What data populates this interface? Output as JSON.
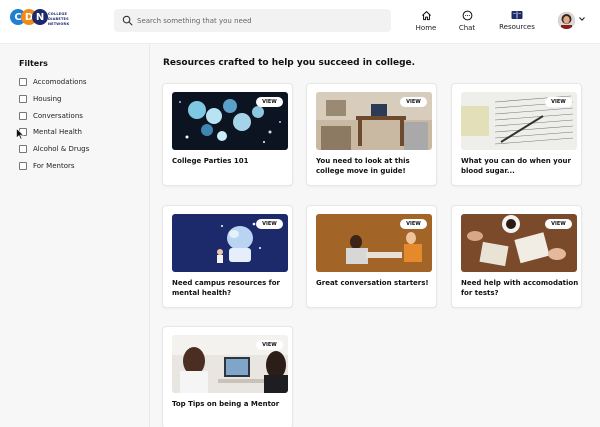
{
  "header": {
    "logo": {
      "letters": [
        "C",
        "D",
        "N"
      ],
      "text_lines": [
        "COLLEGE",
        "DIABETES",
        "NETWORK"
      ]
    },
    "search": {
      "placeholder": "Search something that you need",
      "icon": "search-icon"
    },
    "nav": [
      {
        "label": "Home",
        "icon": "home-icon"
      },
      {
        "label": "Chat",
        "icon": "chat-icon"
      },
      {
        "label": "Resources",
        "icon": "book-icon"
      }
    ],
    "avatar_icon": "avatar"
  },
  "sidebar": {
    "title": "Filters",
    "filters": [
      {
        "label": "Accomodations",
        "checked": false
      },
      {
        "label": "Housing",
        "checked": false
      },
      {
        "label": "Conversations",
        "checked": false
      },
      {
        "label": "Mental Health",
        "checked": false
      },
      {
        "label": "Alcohol & Drugs",
        "checked": false
      },
      {
        "label": "For Mentors",
        "checked": false
      }
    ]
  },
  "main": {
    "title": "Resources crafted to help you succeed in college.",
    "view_label": "VIEW",
    "cards": [
      {
        "title": "College Parties 101"
      },
      {
        "title": "You need to look at this college move in guide!"
      },
      {
        "title": "What you can do when your blood sugar..."
      },
      {
        "title": "Need campus resources for mental health?"
      },
      {
        "title": "Great conversation starters!"
      },
      {
        "title": "Need help with accomodation for tests?"
      },
      {
        "title": "Top Tips on being a Mentor"
      }
    ]
  },
  "colors": {
    "logo_blue": "#1f7fd1",
    "logo_orange": "#f28a1a",
    "logo_navy": "#1c2a6b"
  }
}
